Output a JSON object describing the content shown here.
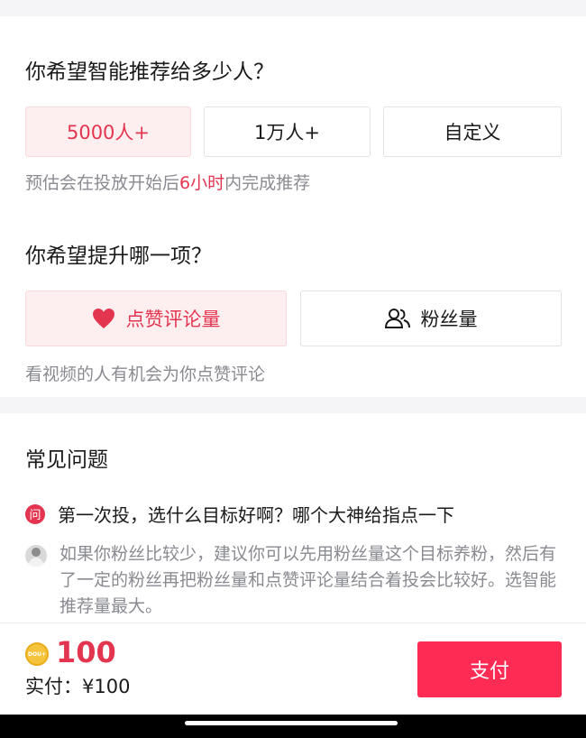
{
  "audience": {
    "title": "你希望智能推荐给多少人？",
    "options": [
      "5000人+",
      "1万人+",
      "自定义"
    ],
    "selected": "5000人+",
    "hint_prefix": "预估会在投放开始后",
    "hint_highlight": "6小时",
    "hint_suffix": "内完成推荐"
  },
  "goal": {
    "title": "你希望提升哪一项？",
    "options": [
      {
        "label": "点赞评论量",
        "icon": "heart-icon"
      },
      {
        "label": "粉丝量",
        "icon": "users-icon"
      }
    ],
    "selected": "点赞评论量",
    "hint": "看视频的人有机会为你点赞评论"
  },
  "faq": {
    "title": "常见问题",
    "question_badge": "问",
    "question": "第一次投，选什么目标好啊？哪个大神给指点一下",
    "answer": "如果你粉丝比较少，建议你可以先用粉丝量这个目标养粉，然后有了一定的粉丝再把粉丝量和点赞评论量结合着投会比较好。选智能推荐量最大。"
  },
  "footer": {
    "coin_label": "DOU+",
    "amount": "100",
    "paid_text": "实付：¥100",
    "pay_label": "支付"
  },
  "colors": {
    "accent": "#e3354f",
    "pay_button": "#fe2c55",
    "selected_bg": "#fdeef0"
  }
}
